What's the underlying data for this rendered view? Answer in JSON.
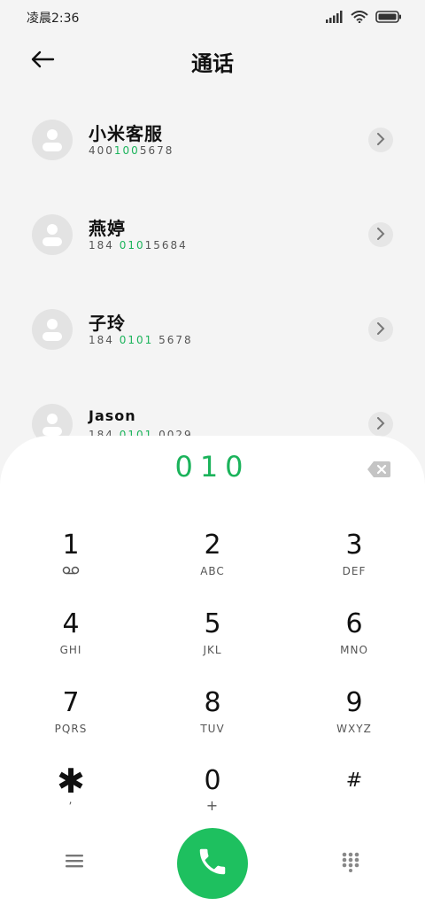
{
  "status_bar": {
    "time": "凌晨2:36"
  },
  "header": {
    "title": "通话"
  },
  "contacts": [
    {
      "name": "小米客服",
      "number_pre": "400",
      "number_match": "100",
      "number_post": "5678"
    },
    {
      "name": "燕婷",
      "number_pre": "184 ",
      "number_match": "010",
      "number_post": "15684"
    },
    {
      "name": "子玲",
      "number_pre": "184 ",
      "number_match": "0101",
      "number_post": " 5678"
    },
    {
      "name": "Jason",
      "number_pre": "184 ",
      "number_match": "0101",
      "number_post": " 0029"
    }
  ],
  "dial_input": "010",
  "keypad": [
    {
      "digit": "1",
      "sub": "voicemail"
    },
    {
      "digit": "2",
      "sub": "ABC"
    },
    {
      "digit": "3",
      "sub": "DEF"
    },
    {
      "digit": "4",
      "sub": "GHI"
    },
    {
      "digit": "5",
      "sub": "JKL"
    },
    {
      "digit": "6",
      "sub": "MNO"
    },
    {
      "digit": "7",
      "sub": "PQRS"
    },
    {
      "digit": "8",
      "sub": "TUV"
    },
    {
      "digit": "9",
      "sub": "WXYZ"
    },
    {
      "digit": "✱",
      "sub": ","
    },
    {
      "digit": "0",
      "sub": "+"
    },
    {
      "digit": "#",
      "sub": ""
    }
  ],
  "icons": {
    "back": "arrow-left-icon",
    "backspace": "backspace-icon",
    "menu": "menu-icon",
    "call": "phone-icon",
    "dialpad_toggle": "dialpad-icon"
  },
  "colors": {
    "accent": "#1bb35b",
    "call_button": "#1ec05f"
  }
}
